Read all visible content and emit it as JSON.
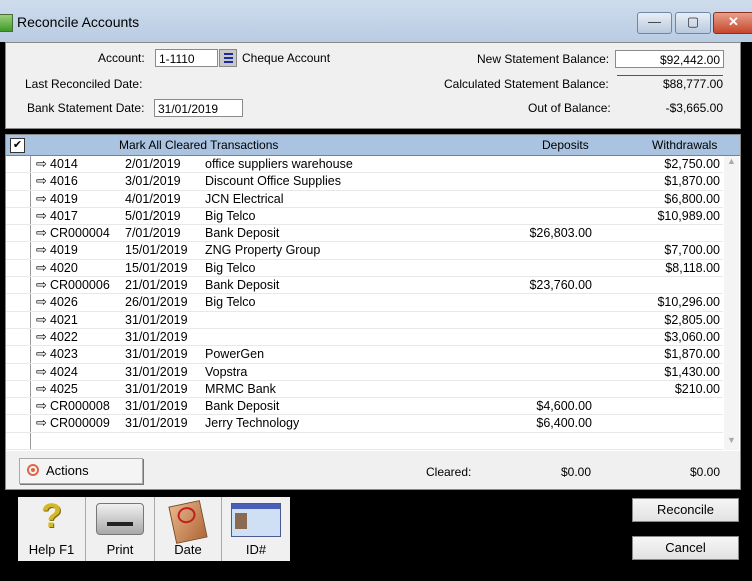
{
  "window": {
    "title": "Reconcile Accounts",
    "controls": {
      "minimize": "—",
      "maximize": "▢",
      "close": "✕"
    }
  },
  "header": {
    "account_label": "Account:",
    "account_value": "1-1110",
    "account_name": "Cheque Account",
    "last_reconciled_label": "Last Reconciled Date:",
    "last_reconciled_value": "",
    "bank_statement_date_label": "Bank Statement Date:",
    "bank_statement_date_value": "31/01/2019",
    "new_statement_balance_label": "New Statement Balance:",
    "new_statement_balance_value": "$92,442.00",
    "calculated_statement_balance_label": "Calculated Statement Balance:",
    "calculated_statement_balance_value": "$88,777.00",
    "out_of_balance_label": "Out of Balance:",
    "out_of_balance_value": "-$3,665.00"
  },
  "grid": {
    "mark_all_checked": true,
    "columns": {
      "mark_all": "Mark All Cleared Transactions",
      "deposits": "Deposits",
      "withdrawals": "Withdrawals"
    },
    "rows": [
      {
        "id": "4014",
        "date": "2/01/2019",
        "description": "office suppliers warehouse",
        "deposit": "",
        "withdrawal": "$2,750.00"
      },
      {
        "id": "4016",
        "date": "3/01/2019",
        "description": "Discount Office Supplies",
        "deposit": "",
        "withdrawal": "$1,870.00"
      },
      {
        "id": "4019",
        "date": "4/01/2019",
        "description": "JCN Electrical",
        "deposit": "",
        "withdrawal": "$6,800.00"
      },
      {
        "id": "4017",
        "date": "5/01/2019",
        "description": "Big Telco",
        "deposit": "",
        "withdrawal": "$10,989.00"
      },
      {
        "id": "CR000004",
        "date": "7/01/2019",
        "description": "Bank Deposit",
        "deposit": "$26,803.00",
        "withdrawal": ""
      },
      {
        "id": "4019",
        "date": "15/01/2019",
        "description": "ZNG Property Group",
        "deposit": "",
        "withdrawal": "$7,700.00"
      },
      {
        "id": "4020",
        "date": "15/01/2019",
        "description": "Big Telco",
        "deposit": "",
        "withdrawal": "$8,118.00"
      },
      {
        "id": "CR000006",
        "date": "21/01/2019",
        "description": "Bank Deposit",
        "deposit": "$23,760.00",
        "withdrawal": ""
      },
      {
        "id": "4026",
        "date": "26/01/2019",
        "description": "Big Telco",
        "deposit": "",
        "withdrawal": "$10,296.00"
      },
      {
        "id": "4021",
        "date": "31/01/2019",
        "description": "",
        "deposit": "",
        "withdrawal": "$2,805.00"
      },
      {
        "id": "4022",
        "date": "31/01/2019",
        "description": "",
        "deposit": "",
        "withdrawal": "$3,060.00"
      },
      {
        "id": "4023",
        "date": "31/01/2019",
        "description": "PowerGen",
        "deposit": "",
        "withdrawal": "$1,870.00"
      },
      {
        "id": "4024",
        "date": "31/01/2019",
        "description": "Vopstra",
        "deposit": "",
        "withdrawal": "$1,430.00"
      },
      {
        "id": "4025",
        "date": "31/01/2019",
        "description": "MRMC Bank",
        "deposit": "",
        "withdrawal": "$210.00"
      },
      {
        "id": "CR000008",
        "date": "31/01/2019",
        "description": "Bank Deposit",
        "deposit": "$4,600.00",
        "withdrawal": ""
      },
      {
        "id": "CR000009",
        "date": "31/01/2019",
        "description": "Jerry Technology",
        "deposit": "$6,400.00",
        "withdrawal": ""
      }
    ]
  },
  "footer": {
    "actions_label": "Actions",
    "cleared_label": "Cleared:",
    "cleared_deposits": "$0.00",
    "cleared_withdrawals": "$0.00"
  },
  "toolbar": {
    "help_label": "Help F1",
    "print_label": "Print",
    "date_label": "Date",
    "id_label": "ID#"
  },
  "buttons": {
    "reconcile": "Reconcile",
    "cancel": "Cancel"
  }
}
